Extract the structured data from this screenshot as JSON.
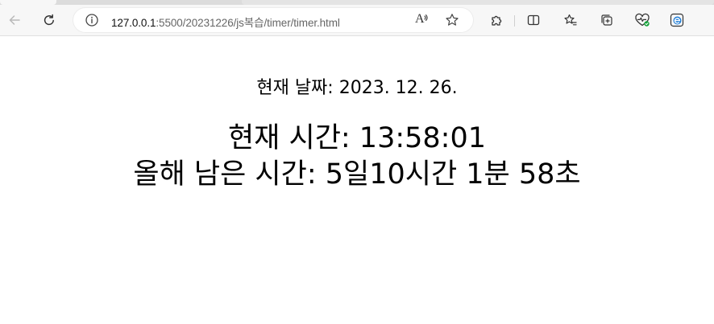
{
  "browser": {
    "url": {
      "host": "127.0.0.1",
      "rest": ":5500/20231226/js복습/timer/timer.html"
    },
    "read_aloud_glyph": "A",
    "icons": {
      "back": "back-arrow-icon",
      "refresh": "refresh-icon",
      "site_info": "info-icon",
      "read_aloud": "read-aloud-icon",
      "favorite": "star-icon",
      "extensions": "puzzle-icon",
      "split_screen": "split-screen-icon",
      "favorites_bar": "favorites-icon",
      "collections": "collections-icon",
      "browser_essentials": "heart-pulse-icon",
      "edge_bar": "edge-icon"
    },
    "colors": {
      "toolbar_bg": "#f7f7f7",
      "edge_blue": "#1d7cd6",
      "essentials_green": "#14a33a"
    }
  },
  "page": {
    "date_label": "현재 날짜: 2023. 12. 26.",
    "time_label": "현재 시간: 13:58:01",
    "remaining_label": "올해 남은 시간: 5일10시간 1분 58초"
  }
}
